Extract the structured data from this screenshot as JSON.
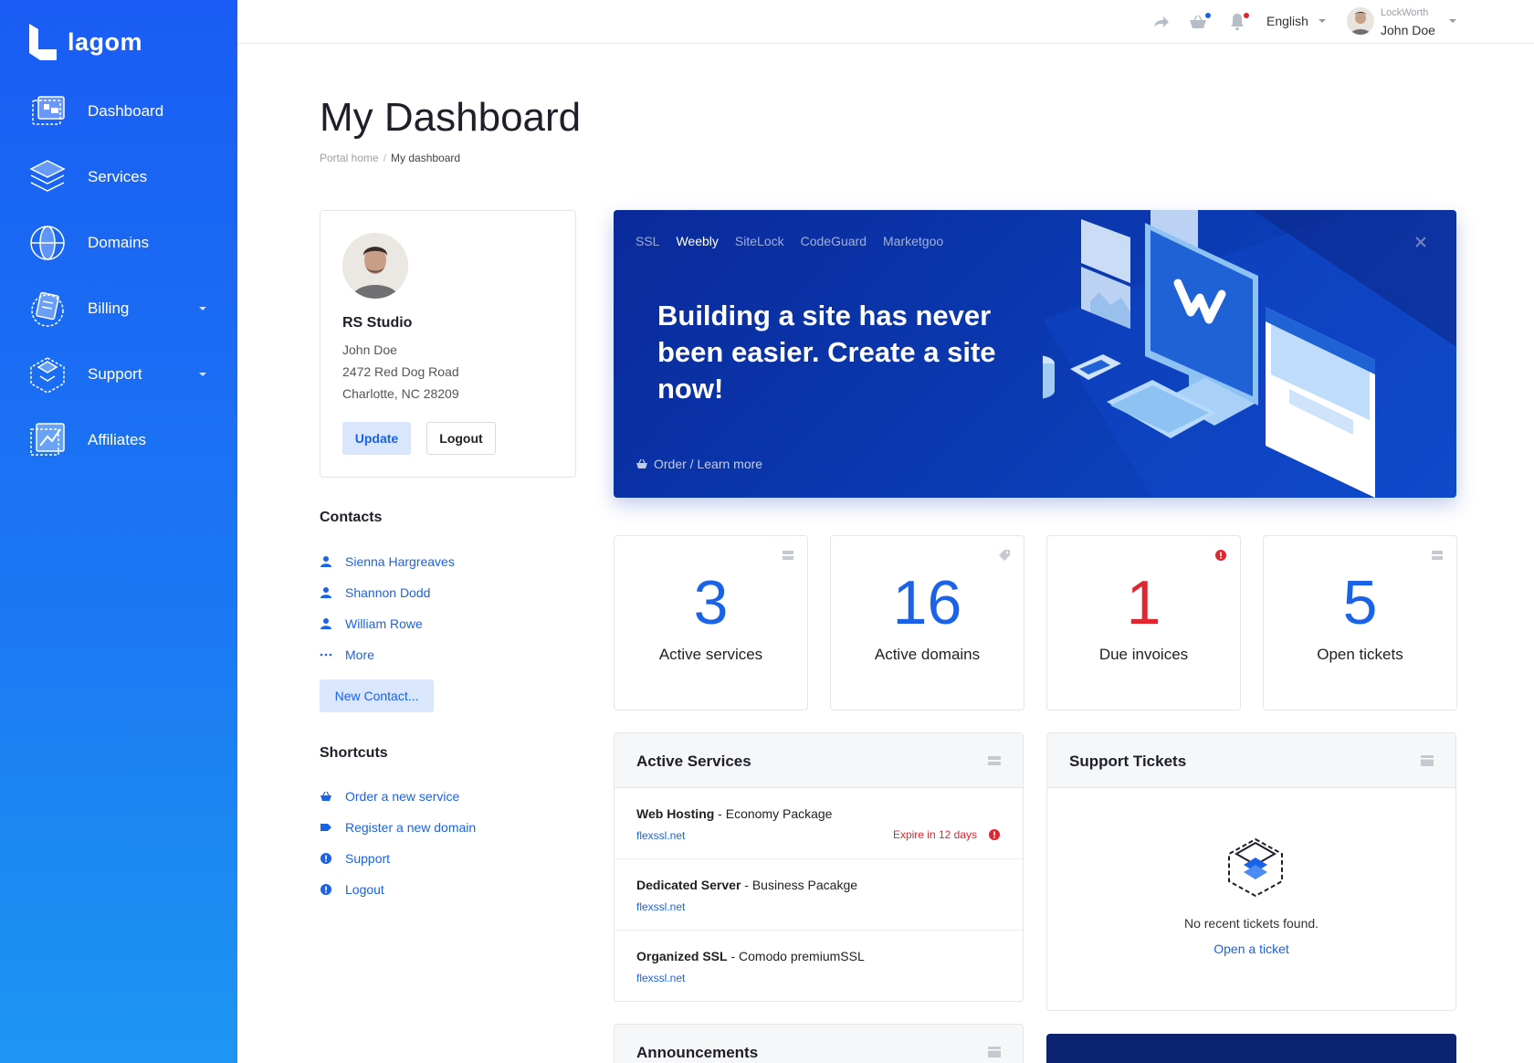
{
  "brand": {
    "name": "lagom",
    "accent": "#1a62e8",
    "danger": "#e0262e"
  },
  "sidebar": {
    "items": [
      {
        "label": "Dashboard",
        "icon": "dashboard-icon",
        "has_caret": false
      },
      {
        "label": "Services",
        "icon": "services-icon",
        "has_caret": false
      },
      {
        "label": "Domains",
        "icon": "domains-icon",
        "has_caret": false
      },
      {
        "label": "Billing",
        "icon": "billing-icon",
        "has_caret": true
      },
      {
        "label": "Support",
        "icon": "support-icon",
        "has_caret": true
      },
      {
        "label": "Affiliates",
        "icon": "affiliates-icon",
        "has_caret": false
      }
    ]
  },
  "topbar": {
    "language": "English",
    "user_company": "LockWorth",
    "user_name": "John Doe"
  },
  "header": {
    "title": "My Dashboard",
    "breadcrumb": [
      "Portal home",
      "My dashboard"
    ],
    "breadcrumb_sep": "/"
  },
  "profile": {
    "company": "RS Studio",
    "name": "John Doe",
    "address1": "2472 Red Dog Road",
    "address2": "Charlotte, NC 28209",
    "update_label": "Update",
    "logout_label": "Logout"
  },
  "contacts": {
    "title": "Contacts",
    "items": [
      "Sienna Hargreaves",
      "Shannon Dodd",
      "William Rowe"
    ],
    "more_label": "More",
    "new_label": "New Contact..."
  },
  "shortcuts": {
    "title": "Shortcuts",
    "items": [
      {
        "label": "Order a new service",
        "icon": "basket-icon"
      },
      {
        "label": "Register a new domain",
        "icon": "tag-icon"
      },
      {
        "label": "Support",
        "icon": "alert-circle-icon"
      },
      {
        "label": "Logout",
        "icon": "alert-circle-icon"
      }
    ]
  },
  "promo": {
    "tabs": [
      "SSL",
      "Weebly",
      "SiteLock",
      "CodeGuard",
      "Marketgoo"
    ],
    "active_tab": "Weebly",
    "headline": "Building a site has never been easier. Create a site now!",
    "link": "Order / Learn more"
  },
  "stats": [
    {
      "value": "3",
      "label": "Active services",
      "icon": "server-icon",
      "color": "#1a62e8"
    },
    {
      "value": "16",
      "label": "Active domains",
      "icon": "tag-icon",
      "color": "#1a62e8"
    },
    {
      "value": "1",
      "label": "Due invoices",
      "icon": "alert-circle-icon",
      "color": "#e0262e"
    },
    {
      "value": "5",
      "label": "Open tickets",
      "icon": "ticket-icon",
      "color": "#1a62e8"
    }
  ],
  "active_services": {
    "title": "Active Services",
    "rows": [
      {
        "product": "Web Hosting",
        "package": " - Economy Package",
        "domain": "flexssl.net",
        "warning": "Expire in 12 days"
      },
      {
        "product": "Dedicated Server",
        "package": " - Business Pacakge",
        "domain": "flexssl.net",
        "warning": ""
      },
      {
        "product": "Organized SSL",
        "package": " - Comodo premiumSSL",
        "domain": "flexssl.net",
        "warning": ""
      }
    ]
  },
  "support_tickets": {
    "title": "Support Tickets",
    "empty_text": "No recent tickets found.",
    "open_link": "Open a ticket"
  },
  "announcements": {
    "title": "Announcements"
  }
}
